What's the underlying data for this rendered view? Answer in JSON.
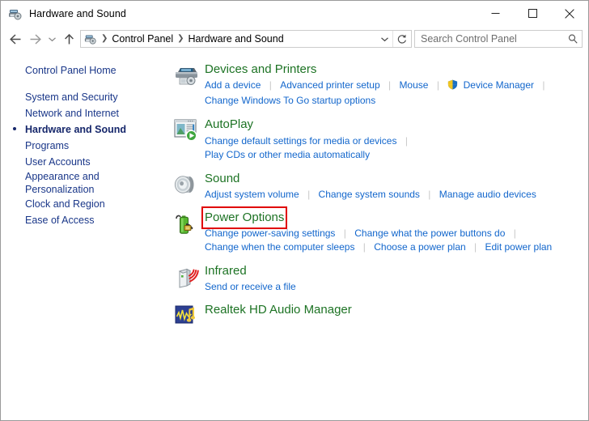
{
  "window": {
    "title": "Hardware and Sound",
    "title_icon": "printer-device-icon",
    "minimize_label": "Minimize",
    "maximize_label": "Maximize",
    "close_label": "Close"
  },
  "toolbar": {
    "back_label": "Back",
    "forward_label": "Forward",
    "recent_label": "Recent locations",
    "up_label": "Up",
    "refresh_label": "Refresh"
  },
  "address": {
    "icon": "control-panel-icon",
    "crumbs": [
      "Control Panel",
      "Hardware and Sound"
    ],
    "separator": "❯",
    "dropdown_icon": "chevron-down-icon",
    "refresh_icon": "refresh-icon"
  },
  "search": {
    "placeholder": "Search Control Panel",
    "value": "",
    "icon": "search-icon"
  },
  "sidebar": {
    "items": [
      {
        "label": "Control Panel Home",
        "current": false,
        "home": true
      },
      {
        "label": "System and Security",
        "current": false
      },
      {
        "label": "Network and Internet",
        "current": false
      },
      {
        "label": "Hardware and Sound",
        "current": true
      },
      {
        "label": "Programs",
        "current": false
      },
      {
        "label": "User Accounts",
        "current": false
      },
      {
        "label": "Appearance and Personalization",
        "current": false
      },
      {
        "label": "Clock and Region",
        "current": false
      },
      {
        "label": "Ease of Access",
        "current": false
      }
    ]
  },
  "main": {
    "categories": [
      {
        "title": "Devices and Printers",
        "icon": "printer-icon",
        "highlight": false,
        "rows": [
          [
            {
              "text": "Add a device"
            },
            {
              "text": "Advanced printer setup"
            },
            {
              "text": "Mouse"
            },
            {
              "text": "Device Manager",
              "shield": true
            }
          ],
          [
            {
              "text": "Change Windows To Go startup options"
            }
          ]
        ]
      },
      {
        "title": "AutoPlay",
        "icon": "autoplay-icon",
        "highlight": false,
        "rows": [
          [
            {
              "text": "Change default settings for media or devices",
              "trailing_separator": true
            }
          ],
          [
            {
              "text": "Play CDs or other media automatically"
            }
          ]
        ]
      },
      {
        "title": "Sound",
        "icon": "speaker-icon",
        "highlight": false,
        "rows": [
          [
            {
              "text": "Adjust system volume"
            },
            {
              "text": "Change system sounds"
            },
            {
              "text": "Manage audio devices"
            }
          ]
        ]
      },
      {
        "title": "Power Options",
        "icon": "battery-power-icon",
        "highlight": true,
        "rows": [
          [
            {
              "text": "Change power-saving settings"
            },
            {
              "text": "Change what the power buttons do",
              "trailing_separator": true
            }
          ],
          [
            {
              "text": "Change when the computer sleeps"
            },
            {
              "text": "Choose a power plan"
            },
            {
              "text": "Edit power plan"
            }
          ]
        ]
      },
      {
        "title": "Infrared",
        "icon": "infrared-icon",
        "highlight": false,
        "rows": [
          [
            {
              "text": "Send or receive a file"
            }
          ]
        ]
      },
      {
        "title": "Realtek HD Audio Manager",
        "icon": "realtek-audio-icon",
        "highlight": false,
        "rows": []
      }
    ]
  },
  "colors": {
    "category_title": "#1d7324",
    "link": "#1266cc",
    "sidebar_link": "#1a3789",
    "highlight_box": "#e00000",
    "window_border": "#9a9a9a"
  }
}
